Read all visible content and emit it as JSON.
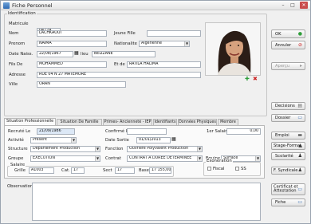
{
  "window": {
    "title": "Fiche Personnel",
    "min": "–",
    "max": "□",
    "close": "✕"
  },
  "identification": {
    "legend": "Identification",
    "matricule_label": "Matricule",
    "matricule": "04724",
    "nom_label": "Nom",
    "nom": "LACHKAOUI",
    "prenom_label": "Prenom",
    "prenom": "NAIMA",
    "jeune_fille_label": "Jeune Fille",
    "jeune_fille": "",
    "nationalite_label": "Nationalite",
    "nationalite": "Algérienne",
    "date_naiss_label": "Date Naiss.",
    "date_naiss": "22/08/1967",
    "lieu_label": "lieu",
    "lieu": "BELIZANE",
    "fils_de_label": "Fils De",
    "fils_de": "MOHAMMED",
    "et_de_label": "Et de",
    "et_de": "RATILA HALIMA",
    "adresse_label": "Adresse",
    "adresse": "RUE 04 N 27 MATEMORE",
    "ville_label": "Ville",
    "ville": "ORAN"
  },
  "photo": {
    "delete_icon": "red-x-icon",
    "add_icon": "green-plus-icon"
  },
  "buttons": {
    "ok": "OK",
    "annuler": "Annuler",
    "apercu": "Aperçu",
    "decisions": "Decisions",
    "dossier": "Dossier",
    "emploi": "Emploi",
    "stage_forma": "Stage-Forma.",
    "scolarite": "Scolarité",
    "f_syndicale": "F. Syndicale",
    "certificat": "Certificat et\nAttestation",
    "fiche": "Fiche"
  },
  "tabs": [
    {
      "label": "Situation Professionnelle"
    },
    {
      "label": "Situation De Famille"
    },
    {
      "label": "Primes- Ancienneté - IEP"
    },
    {
      "label": "Identifiants"
    },
    {
      "label": "Données Physiques"
    },
    {
      "label": "Membre"
    }
  ],
  "situation": {
    "recrute_label": "Recruté Le",
    "recrute": "21/09/1986",
    "confirme_label": "Confirmé Le",
    "confirme": "",
    "salaire1_label": "1er Salaire",
    "salaire1": "0,00",
    "activite_label": "Activité",
    "activite": "Présent",
    "date_sortie_label": "Date Sortie",
    "date_sortie": "01/01/2013",
    "structure_label": "Structure",
    "structure": "Département Production",
    "fonction_label": "Fonction",
    "fonction": "Ouvrière Polyvalent Production",
    "groupe_label": "Groupe",
    "groupe": "EXECUTION",
    "contrat_label": "Contrat",
    "contrat": "CONTRAT A DUREE DETERMINEE",
    "equipe_label": "Equipe",
    "equipe": "Surface",
    "salaire_legend": "Salaire",
    "grille_label": "Grille",
    "grille": "A1003",
    "cat_label": "Cat.",
    "cat": "17",
    "sect_label": "Sect",
    "sect": "17",
    "base_label": "Base",
    "base": "17 155,00",
    "exoneration_legend": "Exonération",
    "fiscal_label": "Fiscal",
    "ss_label": "SS"
  },
  "observations_label": "Observations"
}
